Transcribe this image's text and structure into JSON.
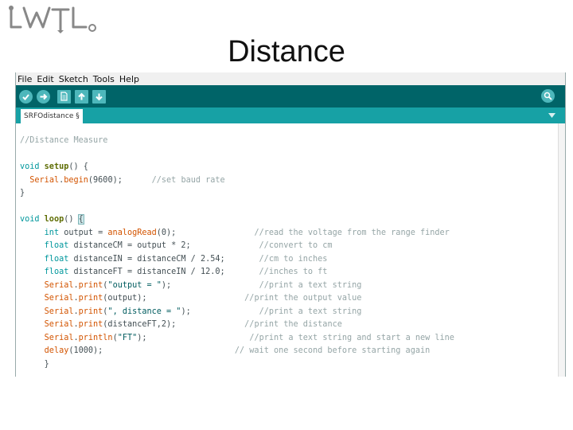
{
  "slide": {
    "title": "Distance"
  },
  "logo": {
    "text": "LWTL"
  },
  "menu": [
    "File",
    "Edit",
    "Sketch",
    "Tools",
    "Help"
  ],
  "toolbar": {
    "icons": [
      "verify-icon",
      "upload-icon",
      "new-icon",
      "open-icon",
      "save-icon",
      "serial-monitor-icon"
    ]
  },
  "tab": {
    "label": "SRFOdistance §"
  },
  "code": {
    "l1": "//Distance Measure",
    "l3a": "void ",
    "l3b": "setup",
    "l3c": "() {",
    "l4a": "  ",
    "l4b": "Serial",
    "l4c": ".",
    "l4d": "begin",
    "l4e": "(9600);      ",
    "l4f": "//set baud rate",
    "l5": "}",
    "l7a": "void ",
    "l7b": "loop",
    "l7c": "() ",
    "l7d": "{",
    "l8a": "     ",
    "l8b": "int",
    "l8c": " output = ",
    "l8d": "analogRead",
    "l8e": "(0);                ",
    "l8f": "//read the voltage from the range finder",
    "l9a": "     ",
    "l9b": "float",
    "l9c": " distanceCM = output * 2;              ",
    "l9d": "//convert to cm",
    "l10a": "     ",
    "l10b": "float",
    "l10c": " distanceIN = distanceCM / 2.54;       ",
    "l10d": "//cm to inches",
    "l11a": "     ",
    "l11b": "float",
    "l11c": " distanceFT = distanceIN / 12.0;       ",
    "l11d": "//inches to ft",
    "l12a": "     ",
    "l12b": "Serial",
    "l12c": ".",
    "l12d": "print",
    "l12e": "(",
    "l12f": "\"output = \"",
    "l12g": ");                  ",
    "l12h": "//print a text string",
    "l13a": "     ",
    "l13b": "Serial",
    "l13c": ".",
    "l13d": "print",
    "l13e": "(output);                    ",
    "l13f": "//print the output value",
    "l14a": "     ",
    "l14b": "Serial",
    "l14c": ".",
    "l14d": "print",
    "l14e": "(",
    "l14f": "\", distance = \"",
    "l14g": ");              ",
    "l14h": "//print a text string",
    "l15a": "     ",
    "l15b": "Serial",
    "l15c": ".",
    "l15d": "print",
    "l15e": "(distanceFT,2);              ",
    "l15f": "//print the distance",
    "l16a": "     ",
    "l16b": "Serial",
    "l16c": ".",
    "l16d": "println",
    "l16e": "(",
    "l16f": "\"FT\"",
    "l16g": ");                     ",
    "l16h": "//print a text string and start a new line",
    "l17a": "     ",
    "l17b": "delay",
    "l17c": "(1000);                           ",
    "l17d": "// wait one second before starting again",
    "l18": "     }"
  }
}
